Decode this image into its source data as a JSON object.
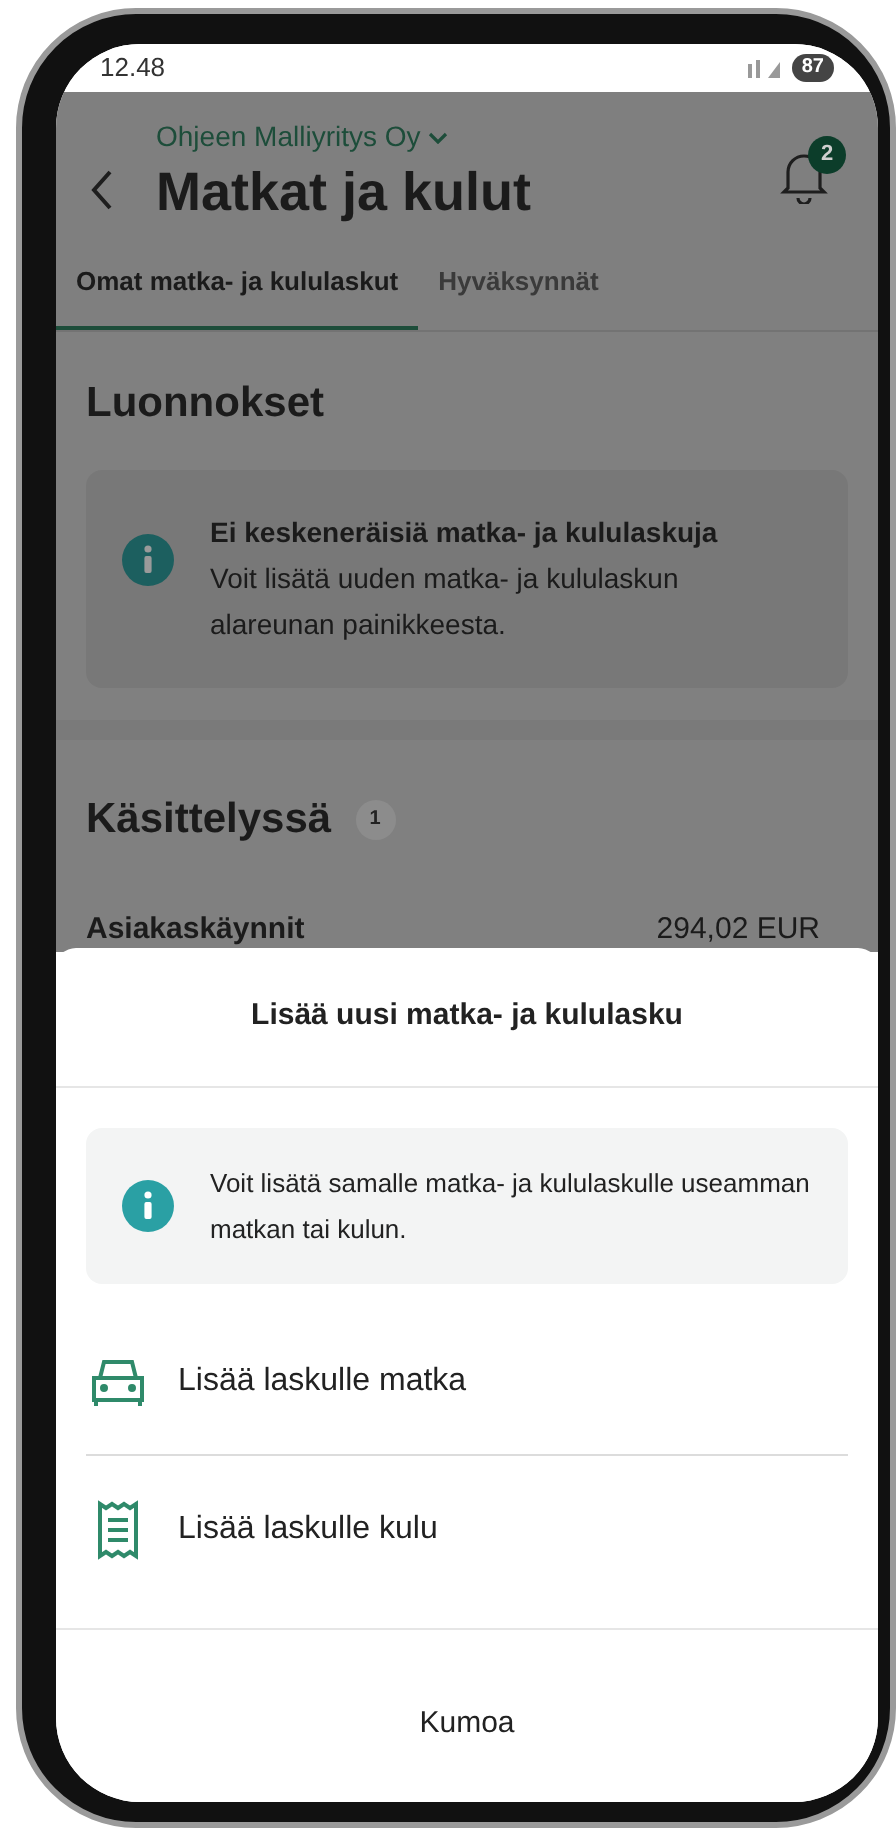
{
  "status_bar": {
    "time": "12.48",
    "battery": "87"
  },
  "header": {
    "company": "Ohjeen Malliyritys Oy",
    "title": "Matkat ja kulut",
    "notification_count": "2"
  },
  "tabs": [
    {
      "label": "Omat matka- ja kululaskut",
      "selected": true
    },
    {
      "label": "Hyväksynnät",
      "selected": false
    }
  ],
  "drafts": {
    "title": "Luonnokset",
    "notice": {
      "title": "Ei keskeneräisiä matka- ja kululaskuja",
      "text": "Voit lisätä uuden matka- ja kululaskun alareunan painikkeesta."
    }
  },
  "processing": {
    "title": "Käsittelyssä",
    "count": "1",
    "rows": [
      {
        "name": "Asiakaskäynnit",
        "amount": "294,02 EUR"
      }
    ]
  },
  "sheet": {
    "title": "Lisää uusi matka- ja kululasku",
    "notice": "Voit lisätä samalle matka- ja kululaskulle useamman matkan tai kulun.",
    "actions": [
      {
        "kind": "car",
        "label": "Lisää laskulle matka"
      },
      {
        "kind": "receipt",
        "label": "Lisää laskulle kulu"
      }
    ],
    "cancel": "Kumoa"
  }
}
